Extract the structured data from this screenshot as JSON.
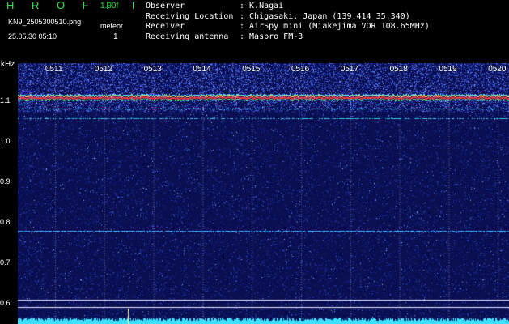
{
  "header": {
    "app_name": "H R O F F T",
    "version": "1.00f",
    "filename": "KN9_2505300510.png",
    "mode_label": "meteor",
    "count": "1",
    "datetime": "25.05.30 05:10"
  },
  "info": [
    {
      "label": "Observer",
      "value": ": K.Nagai"
    },
    {
      "label": "Receiving Location",
      "value": ": Chigasaki, Japan (139.414 35.340)"
    },
    {
      "label": "Receiver",
      "value": ": AirSpy mini (Miakejima VOR 108.65MHz)"
    },
    {
      "label": "Receiving antenna",
      "value": ": Maspro FM-3"
    }
  ],
  "axis": {
    "unit": "kHz",
    "freq_ticks": [
      "1.1",
      "1.0",
      "0.9",
      "0.8",
      "0.7",
      "0.6"
    ],
    "time_ticks": [
      "0511",
      "0512",
      "0513",
      "0514",
      "0515",
      "0516",
      "0517",
      "0518",
      "0519",
      "0520"
    ]
  },
  "colors": {
    "background": "#0a0f5a",
    "logo": "#37e14a",
    "carrier": "#ff4040",
    "trace": "#3de0ff",
    "grid": "#ffffff"
  },
  "icons": {
    "meteor_marker": "meteor-echo-icon"
  }
}
